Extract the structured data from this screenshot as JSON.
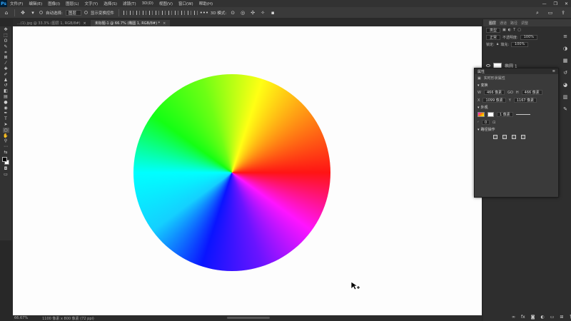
{
  "app": {
    "logo": "Ps"
  },
  "menu": [
    "文件(F)",
    "编辑(E)",
    "图像(I)",
    "图层(L)",
    "文字(Y)",
    "选择(S)",
    "滤镜(T)",
    "3D(D)",
    "视图(V)",
    "窗口(W)",
    "帮助(H)"
  ],
  "window_controls": {
    "minimize": "—",
    "restore": "❐",
    "close": "✕"
  },
  "options": {
    "auto_select_label": "自动选择:",
    "layer_dropdown": "图层",
    "transform_label": "显示变换控件",
    "mode_3d_label": "3D 模式:"
  },
  "tabs": [
    {
      "label": "...(1).jpg @ 33.3% (图层 1, RGB/8#)",
      "active": false
    },
    {
      "label": "未标题-1 @ 66.7% (椭圆 1, RGB/8#) *",
      "active": true
    }
  ],
  "status": {
    "zoom": "66.67%",
    "doc_info": "1100 像素 x 800 像素 (72 ppi)"
  },
  "dock": {
    "tabs": [
      "图层",
      "通道",
      "路径",
      "调整"
    ],
    "kind_label": "类型",
    "blend_mode": "正常",
    "opacity_label": "不透明度:",
    "opacity_value": "100%",
    "lock_label": "锁定:",
    "fill_label": "填充:",
    "fill_value": "100%",
    "layer_name": "椭圆 1"
  },
  "properties": {
    "title": "属性",
    "subtitle": "实时形状属性",
    "transform_section": "变换",
    "w_label": "W",
    "w_value": "466 像素",
    "link_label": "GO",
    "h_label": "H",
    "h_value": "466 像素",
    "x_label": "X",
    "x_value": "1099 像素",
    "y_label": "Y",
    "y_value": "1167 像素",
    "appearance_section": "外观",
    "stroke_width": "1 像素",
    "corner_value": "0",
    "pathfinder_section": "路径操作"
  }
}
